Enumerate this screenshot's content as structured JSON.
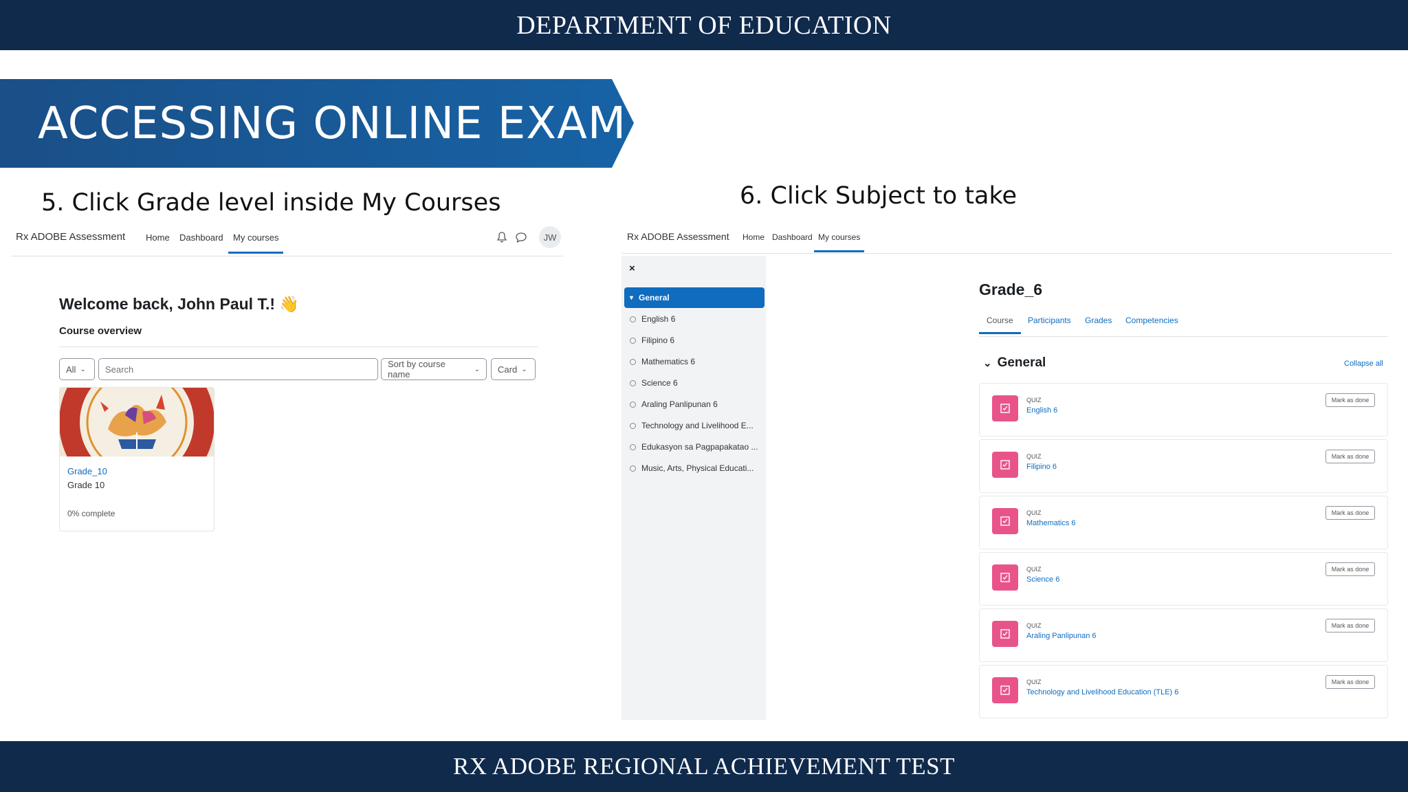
{
  "header": {
    "title": "DEPARTMENT OF EDUCATION"
  },
  "footer": {
    "title": "RX ADOBE REGIONAL ACHIEVEMENT TEST"
  },
  "banner": {
    "title": "ACCESSING ONLINE EXAM"
  },
  "steps": {
    "step5": "5. Click Grade level inside My Courses",
    "step6": "6. Click Subject to take"
  },
  "left_screen": {
    "brand": "Rx ADOBE Assessment",
    "nav": [
      "Home",
      "Dashboard",
      "My courses"
    ],
    "avatar": "JW",
    "welcome": "Welcome back, John Paul T.! 👋",
    "overview": "Course overview",
    "filters": {
      "all": "All",
      "search_placeholder": "Search",
      "sort": "Sort by course name",
      "view": "Card"
    },
    "course": {
      "link": "Grade_10",
      "name": "Grade 10",
      "progress": "0% complete"
    }
  },
  "right_screen": {
    "brand": "Rx ADOBE Assessment",
    "nav": [
      "Home",
      "Dashboard",
      "My courses"
    ],
    "drawer": {
      "close": "×",
      "section": "General",
      "items": [
        "English 6",
        "Filipino 6",
        "Mathematics 6",
        "Science 6",
        "Araling Panlipunan 6",
        "Technology and Livelihood E...",
        "Edukasyon sa Pagpapakatao ...",
        "Music, Arts, Physical Educati..."
      ]
    },
    "course_title": "Grade_6",
    "tabs": [
      "Course",
      "Participants",
      "Grades",
      "Competencies"
    ],
    "section_title": "General",
    "collapse_all": "Collapse all",
    "activities": [
      {
        "type": "QUIZ",
        "name": "English 6",
        "action": "Mark as done"
      },
      {
        "type": "QUIZ",
        "name": "Filipino 6",
        "action": "Mark as done"
      },
      {
        "type": "QUIZ",
        "name": "Mathematics 6",
        "action": "Mark as done"
      },
      {
        "type": "QUIZ",
        "name": "Science 6",
        "action": "Mark as done"
      },
      {
        "type": "QUIZ",
        "name": "Araling Panlipunan 6",
        "action": "Mark as done"
      },
      {
        "type": "QUIZ",
        "name": "Technology and Livelihood Education (TLE) 6",
        "action": "Mark as done"
      }
    ]
  },
  "colors": {
    "navy": "#102a4c",
    "banner_blue": "#15528f",
    "moodle_blue": "#0f6cbf",
    "quiz_pink": "#e8548a"
  }
}
